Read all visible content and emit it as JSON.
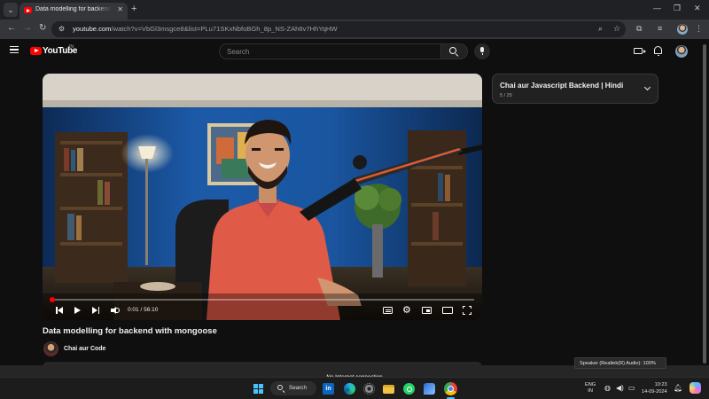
{
  "browser": {
    "tab_title": "Data modelling for backend wi",
    "url_host": "youtube.com",
    "url_path": "/watch?v=VbGl3msgce8&list=PLu71SKxNbfoBGh_8p_NS-ZAh6v7HhYqHW"
  },
  "youtube": {
    "logo_text": "YouTube",
    "country": "IN",
    "search_placeholder": "Search"
  },
  "player": {
    "current_time": "0:01",
    "duration": "56:10",
    "progress_fraction": 0.0003
  },
  "video": {
    "title": "Data modelling for backend with mongoose",
    "channel_name": "Chai aur Code"
  },
  "playlist": {
    "title": "Chai aur Javascript Backend | Hindi",
    "position": "5 / 25"
  },
  "notifications": {
    "connection_status": "No Internet connection",
    "audio_tooltip": "Speaker (Realtek(R) Audio): 100%"
  },
  "taskbar": {
    "search_label": "Search",
    "language_primary": "ENG",
    "language_secondary": "IN",
    "time": "10:23",
    "date": "14-09-2024"
  },
  "icons": {
    "linkedin": "in"
  }
}
